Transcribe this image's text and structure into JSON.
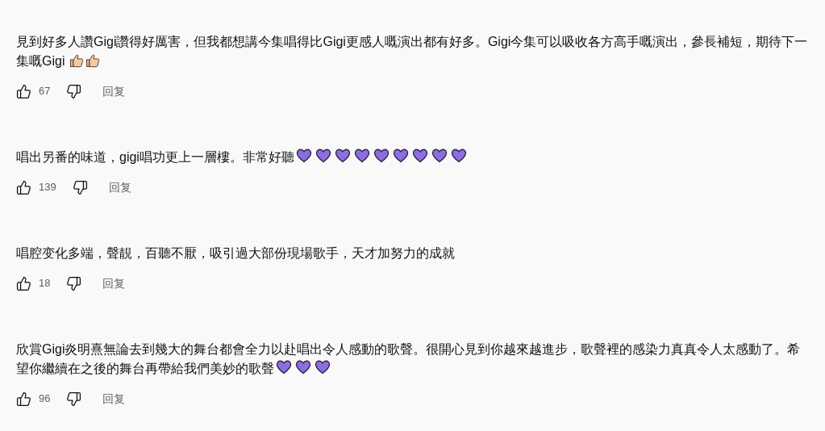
{
  "comments": [
    {
      "text": "見到好多人讚Gigi讚得好厲害，但我都想講今集唱得比Gigi更感人嘅演出都有好多。Gigi今集可以吸收各方高手嘅演出，參長補短，期待下一集嘅Gigi ",
      "emojis": [
        {
          "kind": "thumbs"
        },
        {
          "kind": "thumbs"
        }
      ],
      "likes": "67",
      "reply": "回复"
    },
    {
      "text": "唱出另番的味道，gigi唱功更上一層樓。非常好聽",
      "emojis": [
        {
          "kind": "heart"
        },
        {
          "kind": "heart"
        },
        {
          "kind": "heart"
        },
        {
          "kind": "heart"
        },
        {
          "kind": "heart"
        },
        {
          "kind": "heart"
        },
        {
          "kind": "heart"
        },
        {
          "kind": "heart"
        },
        {
          "kind": "heart"
        }
      ],
      "likes": "139",
      "reply": "回复"
    },
    {
      "text": "唱腔变化多端，聲靚，百聽不厭，吸引過大部份現場歌手，天才加努力的成就",
      "likes": "18",
      "reply": "回复"
    },
    {
      "text": "欣賞Gigi炎明熹無論去到幾大的舞台都會全力以赴唱出令人感動的歌聲。很開心見到你越來越進步，歌聲裡的感染力真真令人太感動了。希望你繼續在之後的舞台再帶給我們美妙的歌聲",
      "emojis": [
        {
          "kind": "heart"
        },
        {
          "kind": "heart"
        },
        {
          "kind": "heart"
        }
      ],
      "likes": "96",
      "reply": "回复"
    }
  ]
}
